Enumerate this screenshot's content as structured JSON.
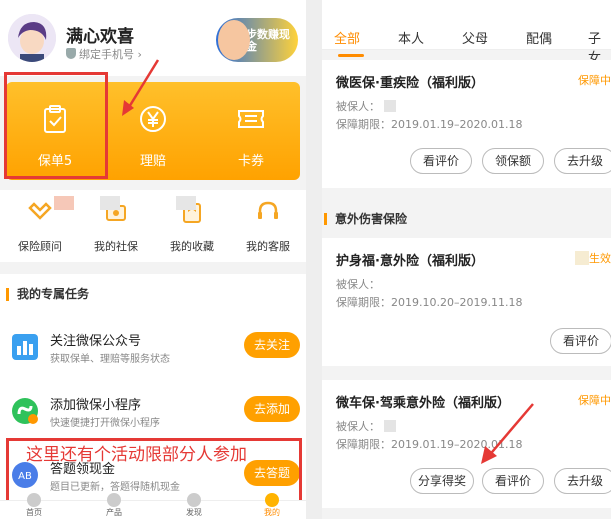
{
  "left": {
    "profile": {
      "name": "满心欢喜",
      "phone_label": "绑定手机号",
      "promo_text": "步数赚现金"
    },
    "card": [
      {
        "label": "保单5",
        "icon": "clipboard-check-icon"
      },
      {
        "label": "理赔",
        "icon": "yen-circle-icon"
      },
      {
        "label": "卡券",
        "icon": "ticket-icon"
      }
    ],
    "quick": [
      {
        "label": "保险顾问",
        "icon": "advisor-icon"
      },
      {
        "label": "我的社保",
        "icon": "social-security-icon"
      },
      {
        "label": "我的收藏",
        "icon": "favorite-icon"
      },
      {
        "label": "我的客服",
        "icon": "headset-icon"
      }
    ],
    "tasks_title": "我的专属任务",
    "tasks": [
      {
        "title": "关注微保公众号",
        "subtitle": "获取保单、理赔等服务状态",
        "button": "去关注"
      },
      {
        "title": "添加微保小程序",
        "subtitle": "快速便捷打开微保小程序",
        "button": "去添加"
      },
      {
        "title": "答题领现金",
        "subtitle": "题目已更新，答题得随机现金",
        "button": "去答题"
      }
    ],
    "annotation": "这里还有个活动限部分人参加",
    "tabbar": [
      "首页",
      "产品",
      "发现",
      "我的"
    ]
  },
  "right": {
    "tabs": [
      "全部",
      "本人",
      "父母",
      "配偶",
      "子女"
    ],
    "policies": [
      {
        "name": "微医保·重疾险（福利版）",
        "status": "保障中",
        "insured_label": "被保人：",
        "period": "保障期限：2019.01.19–2020.01.18",
        "buttons": [
          "看评价",
          "领保额",
          "去升级"
        ]
      }
    ],
    "section_title": "意外伤害保险",
    "accident_policies": [
      {
        "name": "护身福·意外险（福利版）",
        "status": "生效",
        "insured_label": "被保人：",
        "period": "保障期限：2019.10.20–2019.11.18",
        "buttons": [
          "看评价"
        ]
      },
      {
        "name": "微车保·驾乘意外险（福利版）",
        "status": "保障中",
        "insured_label": "被保人：",
        "period": "保障期限：2019.01.19–2020.01.18",
        "buttons": [
          "分享得奖",
          "看评价",
          "去升级"
        ]
      }
    ]
  }
}
